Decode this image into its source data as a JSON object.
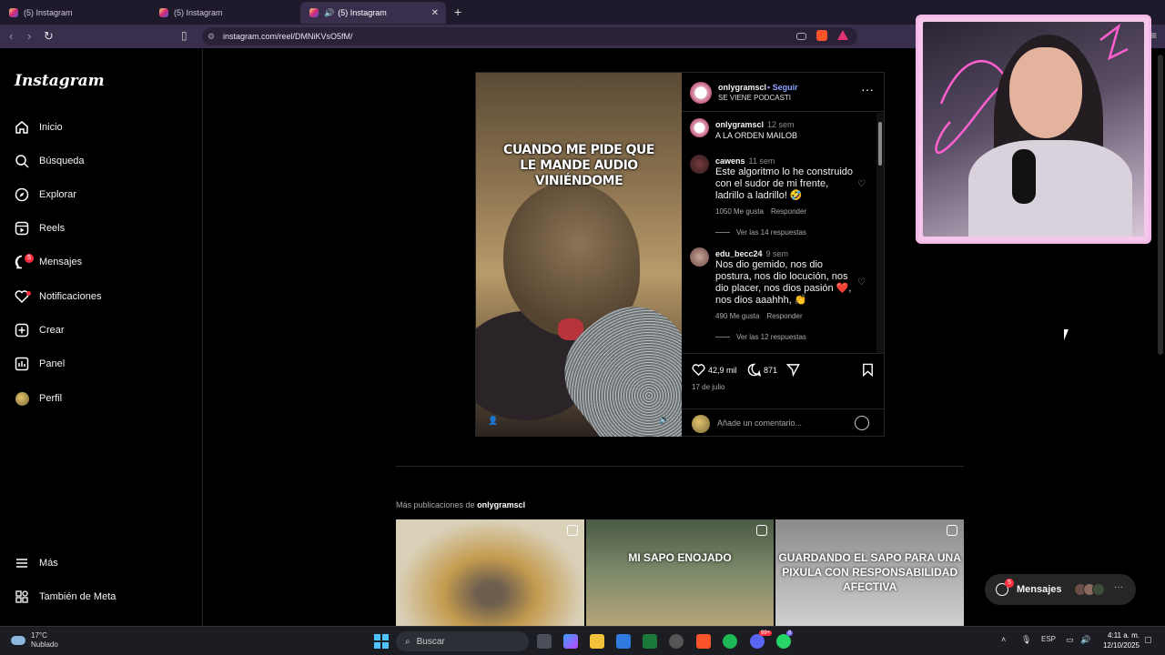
{
  "browser": {
    "tabs": [
      {
        "label": "(5) Instagram"
      },
      {
        "label": "(5) Instagram"
      },
      {
        "label": "(5) Instagram"
      }
    ],
    "url": "instagram.com/reel/DMNiKVsO5fM/"
  },
  "sidebar": {
    "logo": "Instagram",
    "items": [
      {
        "label": "Inicio",
        "icon": "home-icon"
      },
      {
        "label": "Búsqueda",
        "icon": "search-icon"
      },
      {
        "label": "Explorar",
        "icon": "compass-icon"
      },
      {
        "label": "Reels",
        "icon": "reels-icon"
      },
      {
        "label": "Mensajes",
        "icon": "messenger-icon",
        "badge": "5"
      },
      {
        "label": "Notificaciones",
        "icon": "heart-icon"
      },
      {
        "label": "Crear",
        "icon": "plus-square-icon"
      },
      {
        "label": "Panel",
        "icon": "chart-icon"
      },
      {
        "label": "Perfil",
        "icon": "avatar"
      },
      {
        "label": "Más",
        "icon": "menu-icon"
      },
      {
        "label": "También de Meta",
        "icon": "meta-icon"
      }
    ]
  },
  "post": {
    "meme_text": "CUANDO ME PIDE QUE LE MANDE AUDIO VINIÉNDOME",
    "username": "onlygramscl",
    "follow": "Seguir",
    "subtitle": "SE VIENE PODCASTI",
    "comments": [
      {
        "user": "onlygramscl",
        "time": "12 sem",
        "text": "A LA ORDEN MAILOB"
      },
      {
        "user": "cawens",
        "time": "11 sem",
        "text": "Este algoritmo lo he construido con el sudor de mi frente, ladrillo a ladrillo! 🤣",
        "likes": "1050 Me gusta",
        "reply": "Responder",
        "replies": "Ver las 14 respuestas"
      },
      {
        "user": "edu_becc24",
        "time": "9 sem",
        "text": "Nos dio gemido, nos dio postura, nos dio locución, nos dio placer, nos dios pasión ❤️, nos dios aaahhh, 👏",
        "likes": "490 Me gusta",
        "reply": "Responder",
        "replies": "Ver las 12 respuestas"
      }
    ],
    "likes": "42,9 mil",
    "comment_count": "871",
    "date": "17 de julio",
    "add_comment_placeholder": "Añade un comentario..."
  },
  "more": {
    "prefix": "Más publicaciones de",
    "user": "onlygramscl",
    "thumbs": [
      {
        "caption": ""
      },
      {
        "caption": "MI SAPO ENOJADO"
      },
      {
        "caption": "GUARDANDO EL SAPO PARA UNA PIXULA CON RESPONSABILIDAD AFECTIVA"
      }
    ]
  },
  "messages_pill": {
    "label": "Mensajes",
    "badge": "5"
  },
  "taskbar": {
    "temp": "17°C",
    "weather": "Nublado",
    "search": "Buscar",
    "lang": "ESP",
    "time": "4:11 a. m.",
    "date": "12/10/2025",
    "badges": [
      "99+",
      "8"
    ]
  },
  "colors": {
    "accent": "#8ea2ff",
    "badge": "#ff3040",
    "frame": "#f3b9e8"
  }
}
